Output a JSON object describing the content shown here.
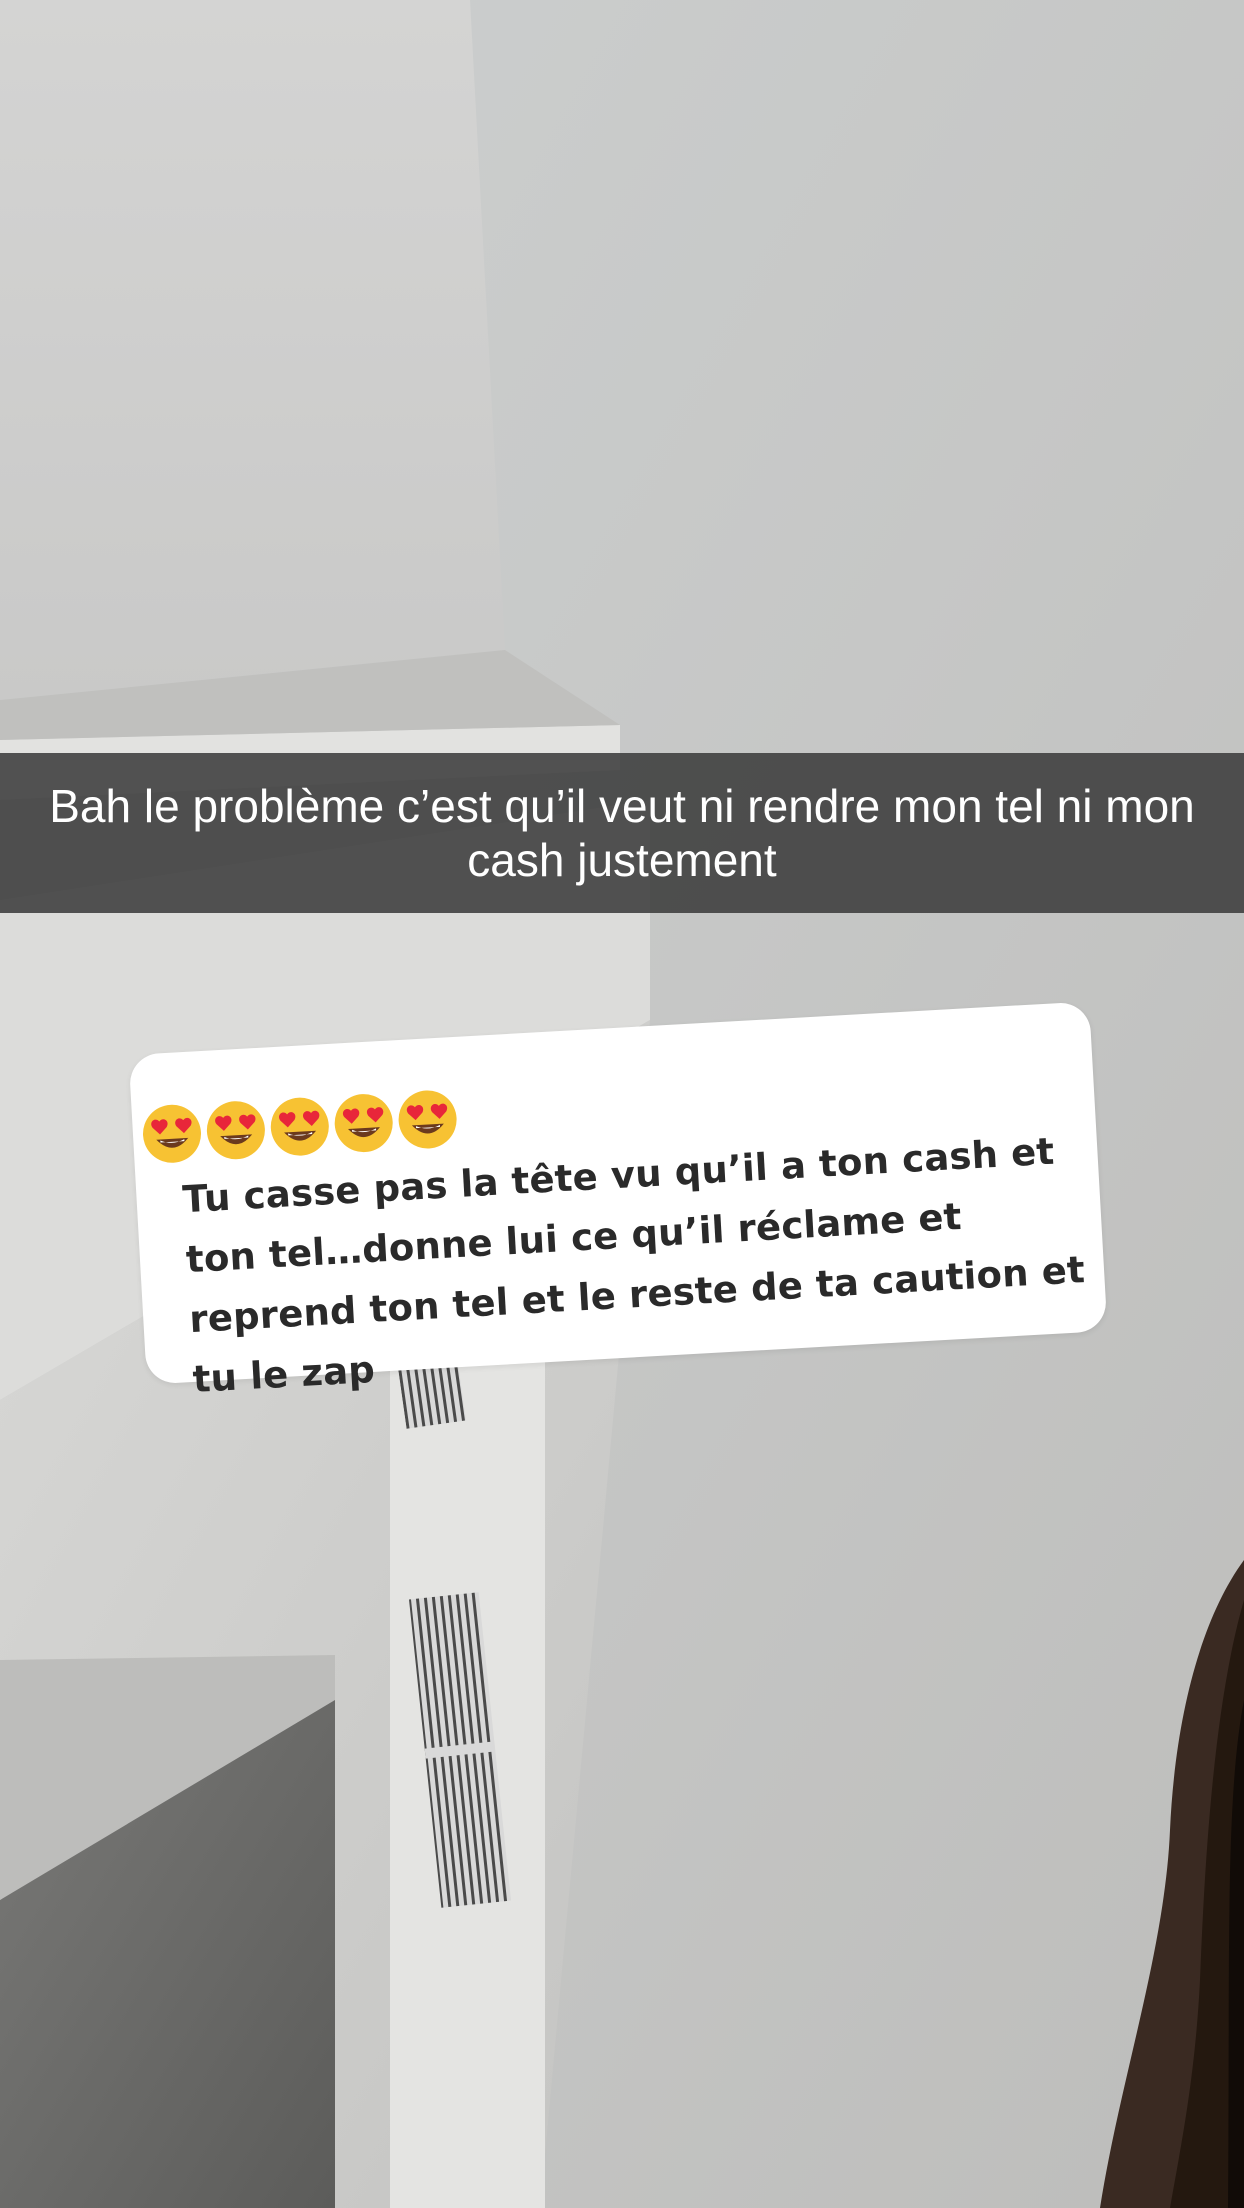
{
  "caption": {
    "text": "Bah le problème c’est qu’il veut ni rendre mon tel ni mon cash justement"
  },
  "reply": {
    "emojis": [
      "heart-eyes-emoji",
      "heart-eyes-emoji",
      "heart-eyes-emoji",
      "heart-eyes-emoji",
      "heart-eyes-emoji"
    ],
    "text": "Tu casse pas la tête vu qu’il a ton cash et ton tel…donne lui ce qu’il réclame et reprend ton tel et le reste de ta caution et tu le zap"
  },
  "colors": {
    "caption_bar": "#3c3c3c",
    "caption_text": "#ffffff",
    "card_background": "#ffffff",
    "card_text": "#2a2a2a"
  }
}
